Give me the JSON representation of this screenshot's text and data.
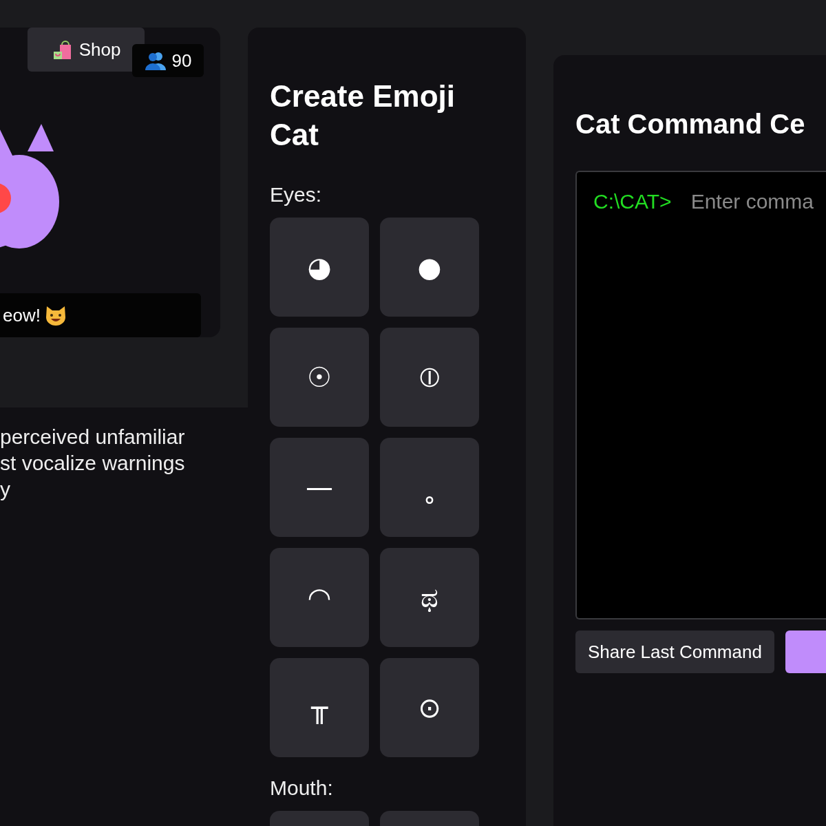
{
  "preview_card": {
    "shop_button": "Shop",
    "followers": "90",
    "speech": "eow!"
  },
  "description": {
    "lines": [
      "perceived unfamiliar",
      "st vocalize warnings",
      "y"
    ]
  },
  "editor": {
    "title": "Create Emoji Cat",
    "eyes_label": "Eyes:",
    "eyes": [
      "◕",
      "●",
      "☉",
      "⦶",
      "—",
      "˳",
      "◠",
      "ಥ",
      "╥",
      "⊙"
    ],
    "mouth_label": "Mouth:"
  },
  "terminal": {
    "title": "Cat Command Ce",
    "prompt": "C:\\CAT>",
    "placeholder": "Enter comma",
    "share_button": "Share Last Command"
  }
}
